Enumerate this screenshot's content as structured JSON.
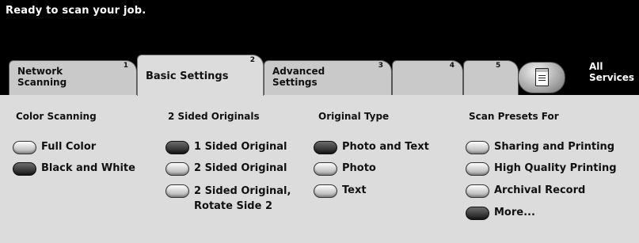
{
  "status": {
    "message": "Ready to scan your job."
  },
  "tabs": [
    {
      "label": "Network\nScanning",
      "number": "1"
    },
    {
      "label": "Basic Settings",
      "number": "2"
    },
    {
      "label": "Advanced\nSettings",
      "number": "3"
    },
    {
      "label": "",
      "number": "4"
    },
    {
      "label": "",
      "number": "5"
    }
  ],
  "all_services": {
    "label": "All\nServices",
    "icon": "document-icon"
  },
  "columns": {
    "color_scanning": {
      "title": "Color Scanning",
      "options": [
        {
          "label": "Full Color",
          "selected": false
        },
        {
          "label": "Black and White",
          "selected": true
        }
      ]
    },
    "two_sided": {
      "title": "2 Sided Originals",
      "options": [
        {
          "label": "1 Sided Original",
          "selected": true
        },
        {
          "label": "2 Sided Original",
          "selected": false
        },
        {
          "label": "2 Sided Original,\nRotate Side 2",
          "selected": false
        }
      ]
    },
    "original_type": {
      "title": "Original Type",
      "options": [
        {
          "label": "Photo and Text",
          "selected": true
        },
        {
          "label": "Photo",
          "selected": false
        },
        {
          "label": "Text",
          "selected": false
        }
      ]
    },
    "scan_presets": {
      "title": "Scan Presets For",
      "options": [
        {
          "label": "Sharing and Printing",
          "selected": false
        },
        {
          "label": "High Quality Printing",
          "selected": false
        },
        {
          "label": "Archival Record",
          "selected": false
        },
        {
          "label": "More...",
          "selected": true
        }
      ]
    }
  },
  "colors": {
    "background": "#000000",
    "panel": "#dcdcdc",
    "tab": "#c9c9c9",
    "selected_button": "#2a2a2a"
  }
}
